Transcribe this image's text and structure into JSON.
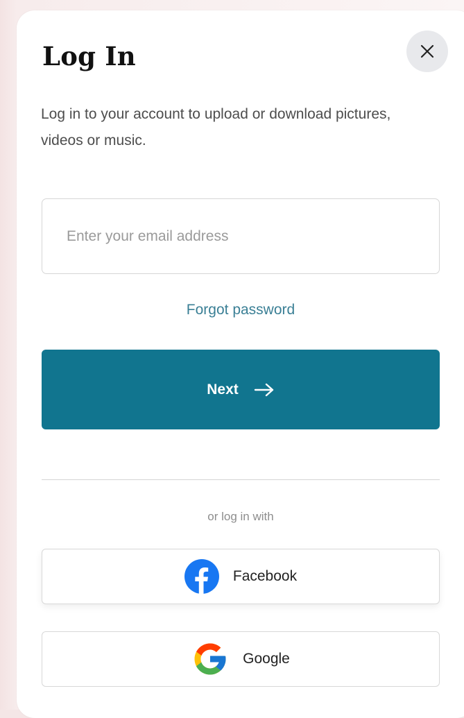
{
  "modal": {
    "title": "Log In",
    "subtitle": "Log in to your account to upload or download pictures, videos or music.",
    "close_icon": "close-icon"
  },
  "form": {
    "email_placeholder": "Enter your email address",
    "email_value": "",
    "forgot_label": "Forgot password",
    "next_label": "Next",
    "next_icon": "arrow-right-icon"
  },
  "social": {
    "divider_text": "or log in with",
    "facebook_label": "Facebook",
    "facebook_icon": "facebook-icon",
    "google_label": "Google",
    "google_icon": "google-icon"
  },
  "colors": {
    "accent": "#11758f",
    "link": "#3a7f95",
    "facebook": "#1877f2",
    "close_bg": "#e8e9ec"
  }
}
